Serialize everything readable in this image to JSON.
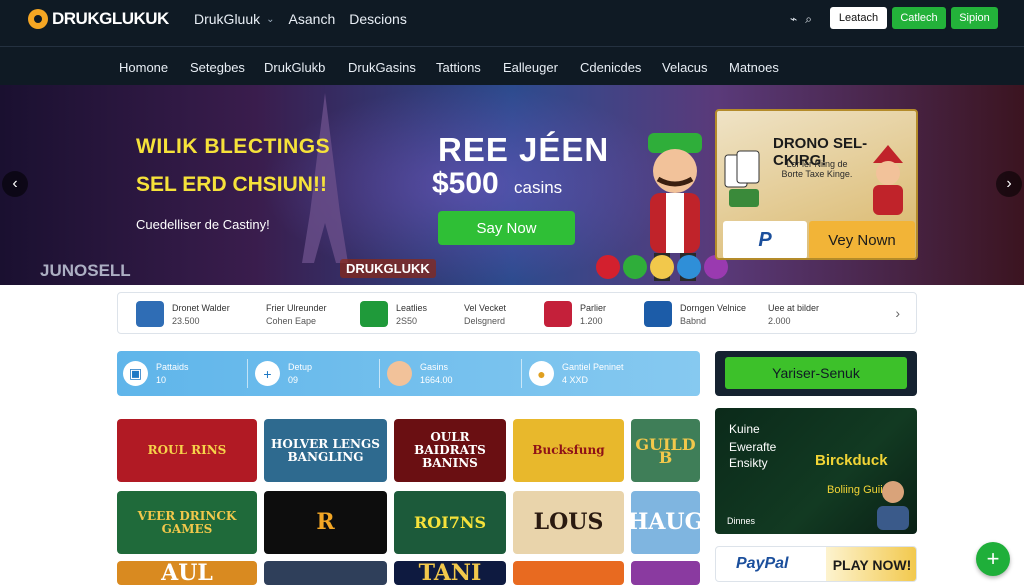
{
  "header": {
    "logo": "DRUKGLUKUK",
    "nav": [
      {
        "label": "DrukGluuk"
      },
      {
        "label": "Asanch"
      },
      {
        "label": "Descions"
      }
    ],
    "buttons": {
      "login": "Leatach",
      "cash": "Catlech",
      "signup": "Sipion"
    }
  },
  "main_nav": [
    "Homone",
    "Setegbes",
    "DrukGlukb",
    "DrukGasins",
    "Tattions",
    "Ealleuger",
    "Cdenicdes",
    "Velacus",
    "Matnoes"
  ],
  "hero": {
    "line1": "WILIK BLECTINGS",
    "line2": "SEL ERD CHSIUN!!",
    "line3": "Cuedelliser de Castiny!",
    "corner": "JUNOSELL",
    "title": "REE JÉEN",
    "amount": "$500",
    "amount_suffix": "casins",
    "cta": "Say Now",
    "brand": "DRUKGLUKK"
  },
  "promo_card": {
    "title": "DRONO SEL-CKIRG!",
    "text": "Lor ler Nilng de Borte Taxe Kinge.",
    "pay_logo": "P",
    "button": "Vey Nown"
  },
  "stats": [
    {
      "label": "Dronet Walder",
      "sub": "23.500",
      "color": "#2f6db5"
    },
    {
      "label": "Frier Ulreunder",
      "sub": "Cohen Eape",
      "color": null
    },
    {
      "label": "Leatlies",
      "sub": "2S50",
      "color": "#1f9a3a"
    },
    {
      "label": "Vel Vecket",
      "sub": "Delsgnerd",
      "color": null
    },
    {
      "label": "Parlier",
      "sub": "1.200",
      "color": "#c4203a"
    },
    {
      "label": "Dorngen Velnice",
      "sub": "Babnd",
      "color": "#1c5ca8"
    },
    {
      "label": "Uee at bilder",
      "sub": "2.000",
      "color": null
    }
  ],
  "info_bar": [
    {
      "label": "Pattaids",
      "sub": "10",
      "icon": "badge-icon"
    },
    {
      "label": "Detup",
      "sub": "09",
      "icon": "plus-icon"
    },
    {
      "label": "Gasins",
      "sub": "1664.00",
      "icon": "avatar-icon"
    },
    {
      "label": "Gantiel Peninet",
      "sub": "4 XXD",
      "icon": "medal-icon"
    }
  ],
  "right_column": {
    "button": "Yariser-Senuk",
    "promo_lines": [
      "Kuine",
      "Ewerafte",
      "Ensikty"
    ],
    "promo_brand": "Birckduck",
    "promo_sub": "Boliing Guiins",
    "promo_foot": "Dinnes",
    "paypal": "PayPal",
    "play_now": "PLAY NOW!"
  },
  "games": [
    {
      "title": "ROUL RINS",
      "bg": "#b11a24",
      "fg": "#f6d34a"
    },
    {
      "title": "HOLVER LENGS BANGLING",
      "bg": "#2e6a8f",
      "fg": "#ffffff"
    },
    {
      "title": "OULR BAIDRATS BANINS",
      "bg": "#6a0f12",
      "fg": "#ffffff"
    },
    {
      "title": "Bucksfung",
      "bg": "#e8b82c",
      "fg": "#8e1217"
    },
    {
      "title": "GUILD B",
      "bg": "#3f7e58",
      "fg": "#f2c84b"
    },
    {
      "title": "VEER DRINCK GAMES",
      "bg": "#1f6a3a",
      "fg": "#f2c84b"
    },
    {
      "title": "R",
      "bg": "#0d0d0d",
      "fg": "#f2a625"
    },
    {
      "title": "ROI7NS",
      "bg": "#1c5a3a",
      "fg": "#f6e23a"
    },
    {
      "title": "LOUS",
      "bg": "#e9d4ab",
      "fg": "#2a1a10"
    },
    {
      "title": "HAUG",
      "bg": "#7fb5e0",
      "fg": "#ffffff"
    },
    {
      "title": "AUL",
      "bg": "#d98a20",
      "fg": "#ffffff"
    },
    {
      "title": "",
      "bg": "#2f3f5a",
      "fg": "#ffffff"
    },
    {
      "title": "TANI",
      "bg": "#0e1a40",
      "fg": "#f2c84b"
    },
    {
      "title": "",
      "bg": "#e86a20",
      "fg": "#ffffff"
    },
    {
      "title": "",
      "bg": "#8a3aa0",
      "fg": "#ffffff"
    }
  ]
}
